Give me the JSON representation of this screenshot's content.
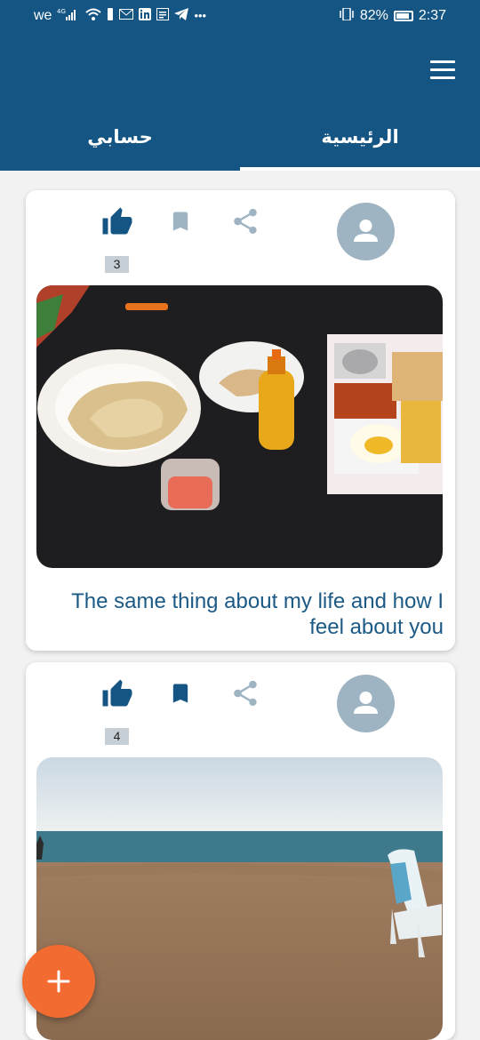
{
  "status_bar": {
    "carrier": "we",
    "network": "4G",
    "icons": [
      "wifi-icon",
      "usb-icon",
      "mail-icon",
      "linkedin-icon",
      "news-icon",
      "telegram-icon",
      "more-icon"
    ],
    "battery_percent": "82%",
    "time": "2:37"
  },
  "app_bar": {
    "menu_icon": "hamburger-menu-icon",
    "tabs": [
      {
        "label": "الرئيسية",
        "active": true
      },
      {
        "label": "حسابي",
        "active": false
      }
    ]
  },
  "posts": [
    {
      "likes": "3",
      "liked": true,
      "bookmarked": false,
      "image_desc": "food",
      "caption": "The same thing about my life and how I feel about you"
    },
    {
      "likes": "4",
      "liked": true,
      "bookmarked": true,
      "image_desc": "beach",
      "caption": ""
    }
  ],
  "fab": {
    "icon": "add-icon"
  },
  "colors": {
    "primary": "#145584",
    "accent": "#f26b30",
    "icon_grey": "#9fb4c2",
    "caption": "#1c5a86"
  }
}
